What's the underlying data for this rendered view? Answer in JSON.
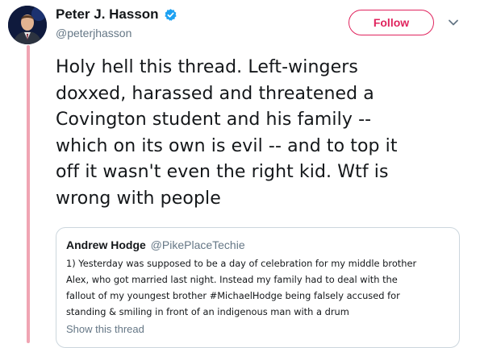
{
  "tweet": {
    "author": {
      "display_name": "Peter J. Hasson",
      "handle": "@peterjhasson",
      "verified_icon": "verified-badge-icon",
      "avatar": "profile-photo"
    },
    "follow_label": "Follow",
    "menu_icon": "chevron-down-icon",
    "text": "Holy hell this thread. Left-wingers\ndoxxed, harassed and threatened a\nCovington student and his family --\nwhich on its own is evil -- and to top it\noff it wasn't even the right kid. Wtf is\nwrong with people",
    "quoted": {
      "author_name": "Andrew Hodge",
      "author_handle": "@PikePlaceTechie",
      "text": "1) Yesterday was supposed to be a day of celebration for my middle brother\nAlex, who got married last night. Instead my family had to deal with the\nfallout of my youngest brother #MichaelHodge being falsely accused for\nstanding & smiling in front of an indigenous man with a drum",
      "show_thread_label": "Show this thread"
    }
  },
  "colors": {
    "accent": "#e0245e",
    "verified": "#1da1f2",
    "thread_line": "#f0a5b3",
    "secondary_text": "#657786",
    "border": "#ccd6dd"
  }
}
